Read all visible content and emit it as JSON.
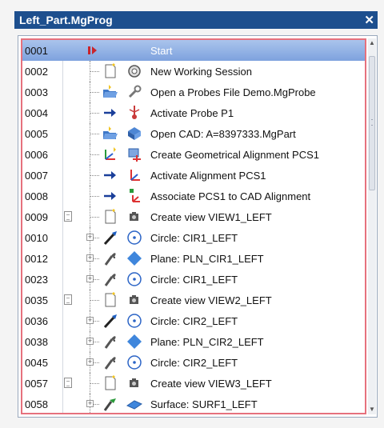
{
  "window": {
    "title": "Left_Part.MgProg",
    "close_glyph": "✕"
  },
  "rows": [
    {
      "num": "0001",
      "label": "Start",
      "icon1": "play-marker-icon",
      "icon2": "",
      "note": false,
      "expander": false,
      "selected": true
    },
    {
      "num": "0002",
      "label": "New Working Session",
      "icon1": "new-document-icon",
      "icon2": "gear-session-icon",
      "note": false,
      "expander": false
    },
    {
      "num": "0003",
      "label": "Open a Probes File Demo.MgProbe",
      "icon1": "open-folder-icon",
      "icon2": "probe-wrench-icon",
      "note": false,
      "expander": false
    },
    {
      "num": "0004",
      "label": "Activate Probe P1",
      "icon1": "arrow-right-icon",
      "icon2": "probe-icon",
      "note": false,
      "expander": false
    },
    {
      "num": "0005",
      "label": "Open CAD: A=8397333.MgPart",
      "icon1": "open-folder-icon",
      "icon2": "cad-part-icon",
      "note": false,
      "expander": false
    },
    {
      "num": "0006",
      "label": "Create Geometrical Alignment PCS1",
      "icon1": "axes-new-icon",
      "icon2": "alignment-icon",
      "note": false,
      "expander": false
    },
    {
      "num": "0007",
      "label": "Activate Alignment PCS1",
      "icon1": "arrow-right-icon",
      "icon2": "axes-icon",
      "note": false,
      "expander": false
    },
    {
      "num": "0008",
      "label": "Associate PCS1 to CAD Alignment",
      "icon1": "arrow-right-icon",
      "icon2": "associate-axes-icon",
      "note": false,
      "expander": false
    },
    {
      "num": "0009",
      "label": "Create view VIEW1_LEFT",
      "icon1": "new-document-icon",
      "icon2": "camera-icon",
      "note": true,
      "expander": false
    },
    {
      "num": "0010",
      "label": "Circle: CIR1_LEFT",
      "icon1": "measure-probe-icon",
      "icon2": "circle-icon",
      "note": false,
      "expander": true
    },
    {
      "num": "0012",
      "label": "Plane: PLN_CIR1_LEFT",
      "icon1": "construct-probe-icon",
      "icon2": "plane-icon",
      "note": false,
      "expander": true
    },
    {
      "num": "0023",
      "label": "Circle: CIR1_LEFT",
      "icon1": "construct-probe-icon",
      "icon2": "circle-icon",
      "note": false,
      "expander": true
    },
    {
      "num": "0035",
      "label": "Create view VIEW2_LEFT",
      "icon1": "new-document-icon",
      "icon2": "camera-icon",
      "note": true,
      "expander": false
    },
    {
      "num": "0036",
      "label": "Circle: CIR2_LEFT",
      "icon1": "measure-probe-icon",
      "icon2": "circle-icon",
      "note": false,
      "expander": true
    },
    {
      "num": "0038",
      "label": "Plane: PLN_CIR2_LEFT",
      "icon1": "construct-probe-icon",
      "icon2": "plane-icon",
      "note": false,
      "expander": true
    },
    {
      "num": "0045",
      "label": "Circle: CIR2_LEFT",
      "icon1": "construct-probe-icon",
      "icon2": "circle-icon",
      "note": false,
      "expander": true
    },
    {
      "num": "0057",
      "label": "Create view VIEW3_LEFT",
      "icon1": "new-document-icon",
      "icon2": "camera-icon",
      "note": true,
      "expander": false
    },
    {
      "num": "0058",
      "label": "Surface: SURF1_LEFT",
      "icon1": "surface-probe-icon",
      "icon2": "surface-icon",
      "note": false,
      "expander": true
    }
  ],
  "colors": {
    "title_bg": "#1d4f8e",
    "selection": "#7ea2de",
    "border_red": "#e6717d"
  }
}
